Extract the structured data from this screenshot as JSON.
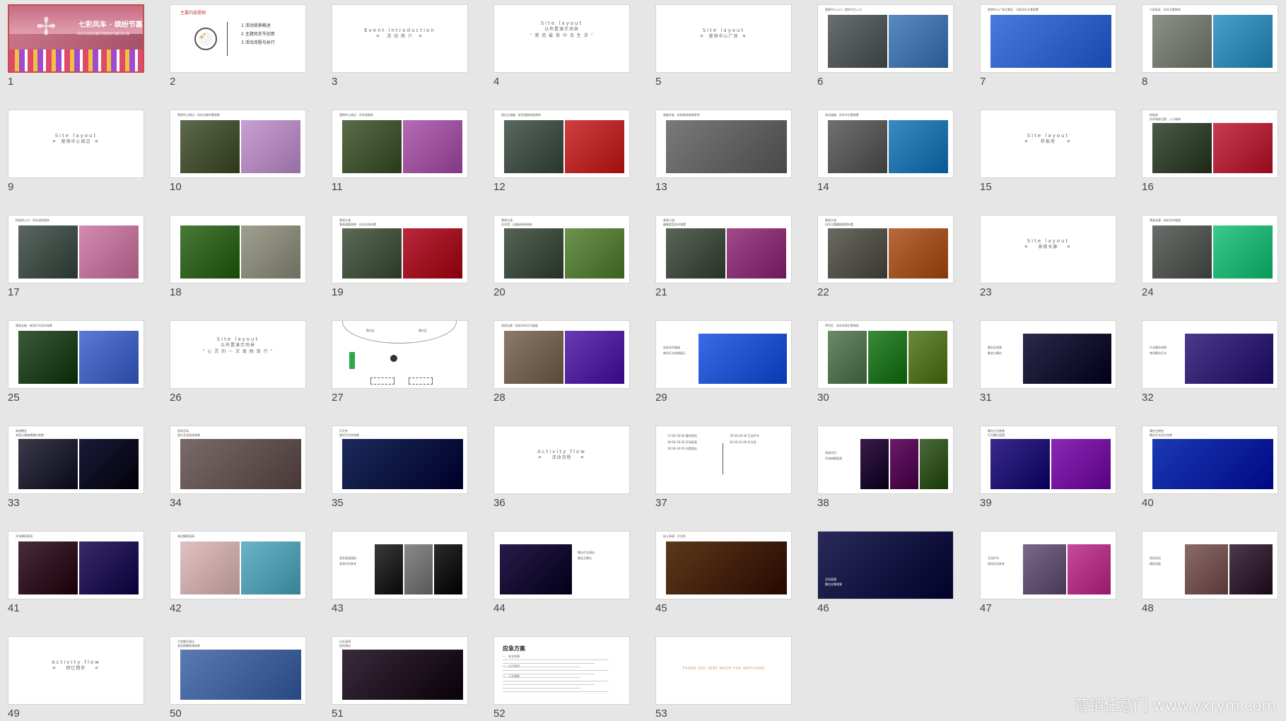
{
  "watermark": "营销任意门 www.yxrym.com",
  "selected": 1,
  "slides": [
    {
      "n": "1",
      "texts": [
        {
          "s": "七彩风车 · 缤纷节嘉",
          "c": "w"
        },
        {
          "s": "2023七彩风车嘉年华暨缤纷节嘉活动方案",
          "c": "w"
        }
      ],
      "ph": [
        "#d88a9a",
        "#c4506a",
        "#6f9a5a",
        "#e8a4b8"
      ]
    },
    {
      "n": "2",
      "texts": [
        {
          "s": "主要内容提纲",
          "c": "r"
        },
        {
          "s": "1  活动背景概述"
        },
        {
          "s": "2  主题风车节创意"
        },
        {
          "s": "3  活动流程与执行"
        }
      ]
    },
    {
      "n": "3",
      "texts": [
        {
          "s": "Event introduction"
        },
        {
          "s": "活 动 简 介"
        }
      ]
    },
    {
      "n": "4",
      "texts": [
        {
          "s": "Site layout"
        },
        {
          "s": "以布置演示场景"
        },
        {
          "s": "“ 营 造 最 美 中 岛 生 活 ”"
        }
      ]
    },
    {
      "n": "5",
      "texts": [
        {
          "s": "Site layout"
        },
        {
          "s": "营销中心广场"
        }
      ]
    },
    {
      "n": "6",
      "texts": [
        {
          "s": "营销中心入口 · 缤纷节主入口"
        }
      ],
      "ph": [
        "#6a7070",
        "#5a8abf"
      ]
    },
    {
      "n": "7",
      "texts": [
        {
          "s": "营销中心广场主景区 · 七彩风车主景装置"
        }
      ],
      "ph": [
        "#4a7adf"
      ]
    },
    {
      "n": "8",
      "texts": [
        {
          "s": "七彩街区 · 风车主题装饰"
        }
      ],
      "ph": [
        "#8c9288",
        "#4aa0c8"
      ]
    },
    {
      "n": "9",
      "texts": [
        {
          "s": "Site layout"
        },
        {
          "s": "营销中心周边"
        }
      ]
    },
    {
      "n": "10",
      "texts": [
        {
          "s": "营销中心周边 · 风车沿路布置效果"
        }
      ],
      "ph": [
        "#5f6a4c",
        "#c8a0d4"
      ]
    },
    {
      "n": "11",
      "texts": [
        {
          "s": "营销中心周边 · 风车墙装饰"
        }
      ],
      "ph": [
        "#5a6c4a",
        "#b46ab4"
      ]
    },
    {
      "n": "12",
      "texts": [
        {
          "s": "周边主道路 · 彩色道路地面装饰"
        }
      ],
      "ph": [
        "#5a6860",
        "#d04040"
      ]
    },
    {
      "n": "13",
      "texts": [
        {
          "s": "道路井盖 · 彩绘装饰效果参考"
        }
      ],
      "ph": [
        "#7a7a7a"
      ]
    },
    {
      "n": "14",
      "texts": [
        {
          "s": "周边道路 · 风车节主题装置"
        }
      ],
      "ph": [
        "#707070",
        "#3a8ac4"
      ]
    },
    {
      "n": "15",
      "texts": [
        {
          "s": "Site layout"
        },
        {
          "s": "样板房"
        }
      ]
    },
    {
      "n": "16",
      "texts": [
        {
          "s": "样板房"
        },
        {
          "s": "风车装饰主题 · 入口装饰"
        }
      ],
      "ph": [
        "#4d5a48",
        "#c83c50"
      ]
    },
    {
      "n": "17",
      "texts": [
        {
          "s": "样板房入口 · 风车迎宾装饰"
        }
      ],
      "ph": [
        "#5a6660",
        "#d48ab0"
      ]
    },
    {
      "n": "18",
      "texts": [],
      "ph": [
        "#4a7a3a",
        "#a0a090"
      ]
    },
    {
      "n": "19",
      "texts": [
        {
          "s": "景观大道"
        },
        {
          "s": "景观道路两侧 · 风车沿线布置"
        }
      ],
      "ph": [
        "#5c6a58",
        "#b8283c"
      ]
    },
    {
      "n": "20",
      "texts": [
        {
          "s": "景观大道"
        },
        {
          "s": "风车墙 · 沿路绿化带装饰"
        }
      ],
      "ph": [
        "#556456",
        "#6c9450"
      ]
    },
    {
      "n": "21",
      "texts": [
        {
          "s": "景观大道"
        },
        {
          "s": "蝴蝶造型花卉装置"
        }
      ],
      "ph": [
        "#5a6458",
        "#a04a8c"
      ]
    },
    {
      "n": "22",
      "texts": [
        {
          "s": "景观大道"
        },
        {
          "s": "风车主题雕塑装置布置"
        }
      ],
      "ph": [
        "#6a6a62",
        "#b86a3a"
      ]
    },
    {
      "n": "23",
      "texts": [
        {
          "s": "Site layout"
        },
        {
          "s": "景观长廊"
        }
      ]
    },
    {
      "n": "24",
      "texts": [
        {
          "s": "景观长廊 · 彩虹风车隧道"
        }
      ],
      "ph": [
        "#6a6e6a",
        "#3acb8c"
      ]
    },
    {
      "n": "25",
      "texts": [
        {
          "s": "景观长廊 · 夜间灯光风车效果"
        }
      ],
      "ph": [
        "#3a5a3a",
        "#5a7ad4"
      ]
    },
    {
      "n": "26",
      "texts": [
        {
          "s": "Site layout"
        },
        {
          "s": "以布置演示场景"
        },
        {
          "s": "“ 心 灵 的 一 次 度 假 旅 行 ”"
        }
      ]
    },
    {
      "n": "27",
      "texts": [
        {
          "s": "舞台区"
        },
        {
          "s": "舞台区"
        }
      ]
    },
    {
      "n": "28",
      "texts": [
        {
          "s": "海滨长廊 · 彩虹风车灯光隧道"
        }
      ],
      "ph": [
        "#8c7a6a",
        "#6a3ab4"
      ]
    },
    {
      "n": "29",
      "texts": [
        {
          "s": "彩虹风车隧道"
        },
        {
          "s": "夜间灯光效果展示"
        }
      ],
      "ph": [
        "#3a6ae4"
      ]
    },
    {
      "n": "30",
      "texts": [
        {
          "s": "草坪区 · 风车花海主景装饰"
        }
      ],
      "ph": [
        "#6a8a6a",
        "#3a8a3a",
        "#6c8a3c"
      ]
    },
    {
      "n": "31",
      "texts": [
        {
          "s": "舞台区效果"
        },
        {
          "s": "晚会主舞台"
        }
      ],
      "ph": [
        "#2a2a4a"
      ]
    },
    {
      "n": "32",
      "texts": [
        {
          "s": "灯光舞台效果"
        },
        {
          "s": "夜间舞台灯光"
        }
      ],
      "ph": [
        "#4a3a8a"
      ]
    },
    {
      "n": "33",
      "texts": [
        {
          "s": "海滨晚会"
        },
        {
          "s": "海滨沙滩夜景舞台效果"
        }
      ],
      "ph": [
        "#3a3a4a",
        "#1a1a3a"
      ]
    },
    {
      "n": "34",
      "texts": [
        {
          "s": "现场活动"
        },
        {
          "s": "观众互动现场效果"
        }
      ],
      "ph": [
        "#7a6a6a"
      ]
    },
    {
      "n": "35",
      "texts": [
        {
          "s": "灯光秀"
        },
        {
          "s": "激光灯光秀效果"
        }
      ],
      "ph": [
        "#1a2a5a"
      ]
    },
    {
      "n": "36",
      "texts": [
        {
          "s": "Activity flow"
        },
        {
          "s": "活动流程"
        }
      ]
    },
    {
      "n": "37",
      "texts": [
        {
          "s": "17:00-18:00  嘉宾签到"
        },
        {
          "s": "18:00-18:30  开场表演"
        },
        {
          "s": "18:30-19:30  主题演出"
        },
        {
          "s": "19:30-20:30  互动环节"
        },
        {
          "s": "20:30-21:00  灯光秀"
        }
      ]
    },
    {
      "n": "38",
      "texts": [
        {
          "s": "表演节目"
        },
        {
          "s": "开场热舞表演"
        }
      ],
      "ph": [
        "#3a1a4a",
        "#6a1a6a",
        "#4a6a3a"
      ]
    },
    {
      "n": "39",
      "texts": [
        {
          "s": "舞台灯光效果"
        },
        {
          "s": "灯光舞台氛围"
        }
      ],
      "ph": [
        "#3a2a8a",
        "#8a2ab4"
      ]
    },
    {
      "n": "40",
      "texts": [
        {
          "s": "舞台主视觉"
        },
        {
          "s": "舞台灯光设计效果"
        }
      ],
      "ph": [
        "#1a3ab4"
      ]
    },
    {
      "n": "41",
      "texts": [
        {
          "s": "开场舞蹈表演"
        }
      ],
      "ph": [
        "#4a2a3a",
        "#3a2a6a"
      ]
    },
    {
      "n": "42",
      "texts": [
        {
          "s": "海边舞蹈表演"
        }
      ],
      "ph": [
        "#e0c0c0",
        "#6ab4c8"
      ]
    },
    {
      "n": "43",
      "texts": [
        {
          "s": "演艺表演团体"
        },
        {
          "s": "表演节目参考"
        }
      ],
      "ph": [
        "#3a3a3a",
        "#8a8a8a",
        "#2a2a2a"
      ]
    },
    {
      "n": "44",
      "texts": [
        {
          "s": "舞台灯光演出"
        },
        {
          "s": "晚会主舞台"
        }
      ],
      "ph": [
        "#2a1a4a"
      ]
    },
    {
      "n": "45",
      "texts": [
        {
          "s": "焰火表演 · 灯光秀"
        }
      ],
      "ph": [
        "#5a3a1a"
      ]
    },
    {
      "n": "46",
      "texts": [
        {
          "s": "活动高潮"
        },
        {
          "s": "舞台全景效果"
        }
      ],
      "ph": [
        "#2a2a5a"
      ]
    },
    {
      "n": "47",
      "texts": [
        {
          "s": "互动环节"
        },
        {
          "s": "现场活动参考"
        }
      ],
      "ph": [
        "#7a6a8a",
        "#c84a9a"
      ]
    },
    {
      "n": "48",
      "texts": [
        {
          "s": "现场活动"
        },
        {
          "s": "精彩回顾"
        }
      ],
      "ph": [
        "#8a6a6a",
        "#4a3a4a"
      ]
    },
    {
      "n": "49",
      "texts": [
        {
          "s": "Activity flow"
        },
        {
          "s": "回忆精彩"
        }
      ]
    },
    {
      "n": "50",
      "texts": [
        {
          "s": "大型舞台演出"
        },
        {
          "s": "演员群舞表演效果"
        }
      ],
      "ph": [
        "#5a7ab4"
      ]
    },
    {
      "n": "51",
      "texts": [
        {
          "s": "乐队表演"
        },
        {
          "s": "现场演出"
        }
      ],
      "ph": [
        "#3a2a3a"
      ]
    },
    {
      "n": "52",
      "texts": [
        {
          "s": "应急方案",
          "c": "b"
        },
        {
          "s": "一、安全保障"
        },
        {
          "s": "二、天气预案"
        },
        {
          "s": "三、人员疏散"
        }
      ]
    },
    {
      "n": "53",
      "texts": [
        {
          "s": "THANK YOU VERY MUCH FOR WATCHING",
          "c": "o"
        }
      ]
    }
  ]
}
